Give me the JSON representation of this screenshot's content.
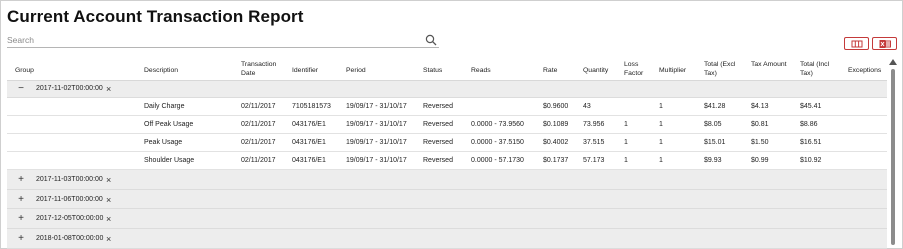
{
  "page": {
    "title": "Current Account Transaction Report",
    "search_placeholder": "Search"
  },
  "icons": {
    "search": "search-icon",
    "column_chooser": "columns-icon",
    "export": "excel-export-icon",
    "accent_color": "#c43a3a"
  },
  "table": {
    "headers": {
      "group": "Group",
      "description": "Description",
      "transaction_date": "Transaction Date",
      "identifier": "Identifier",
      "period": "Period",
      "status": "Status",
      "reads": "Reads",
      "rate": "Rate",
      "quantity": "Quantity",
      "loss_factor": "Loss Factor",
      "multiplier": "Multiplier",
      "total_excl_tax": "Total (Excl Tax)",
      "tax_amount": "Tax Amount",
      "total_incl_tax": "Total (Incl Tax)",
      "exceptions": "Exceptions"
    },
    "groups": [
      {
        "toggle": "−",
        "label": "2017-11-02T00:00:00",
        "close": "×",
        "expanded": true,
        "rows": [
          {
            "description": "Daily Charge",
            "transaction_date": "02/11/2017",
            "identifier": "7105181573",
            "period": "19/09/17 - 31/10/17",
            "status": "Reversed",
            "reads": "",
            "rate": "$0.9600",
            "quantity": "43",
            "loss_factor": "",
            "multiplier": "1",
            "total_excl_tax": "$41.28",
            "tax_amount": "$4.13",
            "total_incl_tax": "$45.41",
            "exceptions": ""
          },
          {
            "description": "Off Peak Usage",
            "transaction_date": "02/11/2017",
            "identifier": "043176/E1",
            "period": "19/09/17 - 31/10/17",
            "status": "Reversed",
            "reads": "0.0000 - 73.9560",
            "rate": "$0.1089",
            "quantity": "73.956",
            "loss_factor": "1",
            "multiplier": "1",
            "total_excl_tax": "$8.05",
            "tax_amount": "$0.81",
            "total_incl_tax": "$8.86",
            "exceptions": ""
          },
          {
            "description": "Peak Usage",
            "transaction_date": "02/11/2017",
            "identifier": "043176/E1",
            "period": "19/09/17 - 31/10/17",
            "status": "Reversed",
            "reads": "0.0000 - 37.5150",
            "rate": "$0.4002",
            "quantity": "37.515",
            "loss_factor": "1",
            "multiplier": "1",
            "total_excl_tax": "$15.01",
            "tax_amount": "$1.50",
            "total_incl_tax": "$16.51",
            "exceptions": ""
          },
          {
            "description": "Shoulder Usage",
            "transaction_date": "02/11/2017",
            "identifier": "043176/E1",
            "period": "19/09/17 - 31/10/17",
            "status": "Reversed",
            "reads": "0.0000 - 57.1730",
            "rate": "$0.1737",
            "quantity": "57.173",
            "loss_factor": "1",
            "multiplier": "1",
            "total_excl_tax": "$9.93",
            "tax_amount": "$0.99",
            "total_incl_tax": "$10.92",
            "exceptions": ""
          }
        ]
      },
      {
        "toggle": "+",
        "label": "2017-11-03T00:00:00",
        "close": "×",
        "expanded": false,
        "rows": []
      },
      {
        "toggle": "+",
        "label": "2017-11-06T00:00:00",
        "close": "×",
        "expanded": false,
        "rows": []
      },
      {
        "toggle": "+",
        "label": "2017-12-05T00:00:00",
        "close": "×",
        "expanded": false,
        "rows": []
      },
      {
        "toggle": "+",
        "label": "2018-01-08T00:00:00",
        "close": "×",
        "expanded": false,
        "rows": []
      }
    ]
  }
}
